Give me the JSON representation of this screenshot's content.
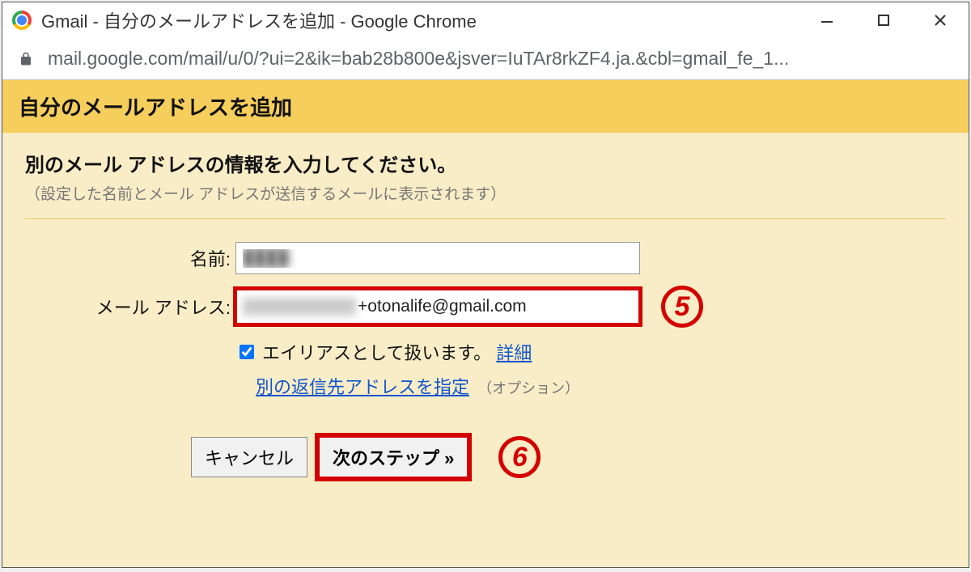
{
  "window": {
    "title": "Gmail - 自分のメールアドレスを追加 - Google Chrome"
  },
  "addressbar": {
    "url": "mail.google.com/mail/u/0/?ui=2&ik=bab28b800e&jsver=IuTAr8rkZF4.ja.&cbl=gmail_fe_1..."
  },
  "header": {
    "title": "自分のメールアドレスを追加"
  },
  "form": {
    "instruction": "別のメール アドレスの情報を入力してください。",
    "subtext": "（設定した名前とメール アドレスが送信するメールに表示されます）",
    "name_label": "名前:",
    "name_value": "████",
    "email_label": "メール アドレス:",
    "email_visible_part": "+otonalife@gmail.com",
    "alias_checkbox_label": "エイリアスとして扱います。",
    "alias_detail_link": "詳細",
    "reply_link": "別の返信先アドレスを指定",
    "reply_optional": "（オプション）",
    "cancel_button": "キャンセル",
    "next_button": "次のステップ »"
  },
  "annotations": {
    "five": "5",
    "six": "6"
  }
}
